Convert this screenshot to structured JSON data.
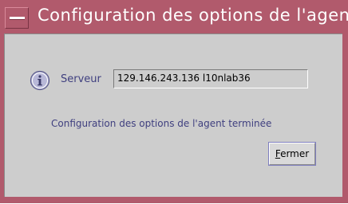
{
  "window": {
    "title": "Configuration des options de l'agent"
  },
  "server": {
    "label": "Serveur",
    "value": "129.146.243.136 l10nlab36"
  },
  "message": "Configuration des options de l'agent terminée",
  "close_button": {
    "mnemonic": "F",
    "rest": "ermer"
  },
  "colors": {
    "titlebar": "#b15a6c",
    "dialog_background": "#cdcdcd",
    "label_text": "#3f3f7f"
  },
  "icons": {
    "window_menu": "window-menu-icon",
    "info": "info-icon"
  }
}
